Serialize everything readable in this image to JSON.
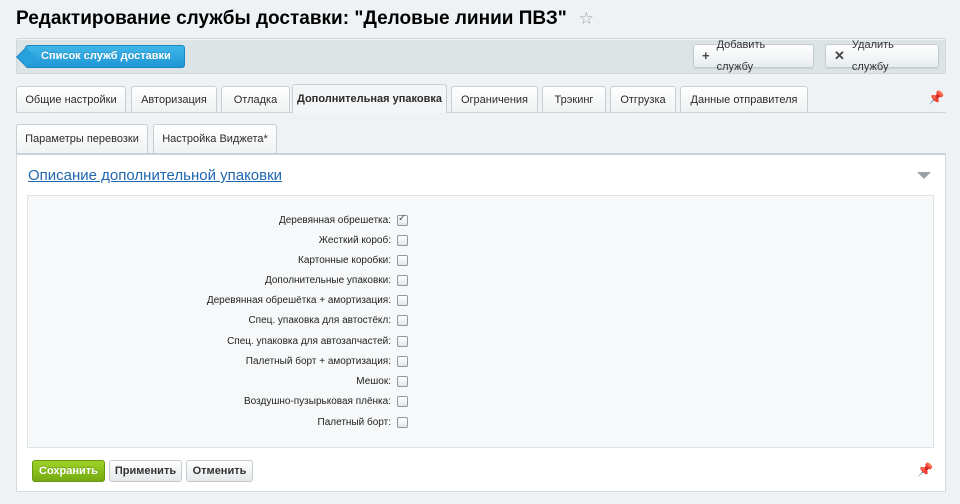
{
  "page": {
    "title": "Редактирование службы доставки: \"Деловые линии ПВЗ\"",
    "star_icon": "☆"
  },
  "toolbar": {
    "list_label": "Список служб доставки",
    "add_label": "Добавить службу",
    "add_icon": "+",
    "delete_label": "Удалить службу",
    "delete_icon": "✕"
  },
  "tabs": [
    {
      "label": "Общие настройки"
    },
    {
      "label": "Авторизация"
    },
    {
      "label": "Отладка"
    },
    {
      "label": "Дополнительная упаковка",
      "active": true
    },
    {
      "label": "Ограничения"
    },
    {
      "label": "Трэкинг"
    },
    {
      "label": "Отгрузка"
    },
    {
      "label": "Данные отправителя"
    }
  ],
  "subtabs": [
    {
      "label": "Параметры перевозки"
    },
    {
      "label": "Настройка Виджета*"
    }
  ],
  "section": {
    "title": "Описание дополнительной упаковки",
    "fields": [
      {
        "label": "Деревянная обрешетка:",
        "checked": true
      },
      {
        "label": "Жесткий короб:",
        "checked": false
      },
      {
        "label": "Картонные коробки:",
        "checked": false
      },
      {
        "label": "Дополнительные упаковки:",
        "checked": false
      },
      {
        "label": "Деревянная обрешётка + амортизация:",
        "checked": false
      },
      {
        "label": "Спец. упаковка для автостёкл:",
        "checked": false
      },
      {
        "label": "Спец. упаковка для автозапчастей:",
        "checked": false
      },
      {
        "label": "Палетный борт + амортизация:",
        "checked": false
      },
      {
        "label": "Мешок:",
        "checked": false
      },
      {
        "label": "Воздушно-пузырьковая плёнка:",
        "checked": false
      },
      {
        "label": "Палетный борт:",
        "checked": false
      }
    ]
  },
  "buttons": {
    "save": "Сохранить",
    "apply": "Применить",
    "cancel": "Отменить"
  },
  "pin_icon": "📌",
  "colors": {
    "accent_blue": "#1f96d4",
    "save_green": "#74aa12",
    "link_blue": "#2067b0"
  }
}
